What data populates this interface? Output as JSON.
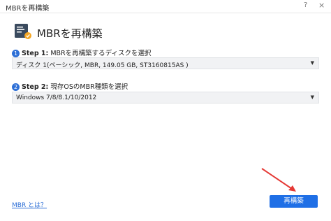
{
  "window": {
    "title": "MBRを再構築",
    "help_icon": "?",
    "close_icon": "×"
  },
  "header": {
    "icon": "disk-rebuild-icon",
    "title": "MBRを再構築"
  },
  "step1": {
    "number": "1",
    "label_bold": "Step 1:",
    "label_text": " MBRを再構築するディスクを選択",
    "selected_value": "ディスク 1(ベーシック, MBR, 149.05 GB, ST3160815AS )"
  },
  "step2": {
    "number": "2",
    "label_bold": "Step 2:",
    "label_text": " 現存OSのMBR種類を選択",
    "selected_value": "Windows 7/8/8.1/10/2012"
  },
  "footer": {
    "help_link": "MBR とは？",
    "primary_button": "再構築"
  },
  "colors": {
    "accent": "#1f6fe6",
    "arrow": "#e53935"
  }
}
